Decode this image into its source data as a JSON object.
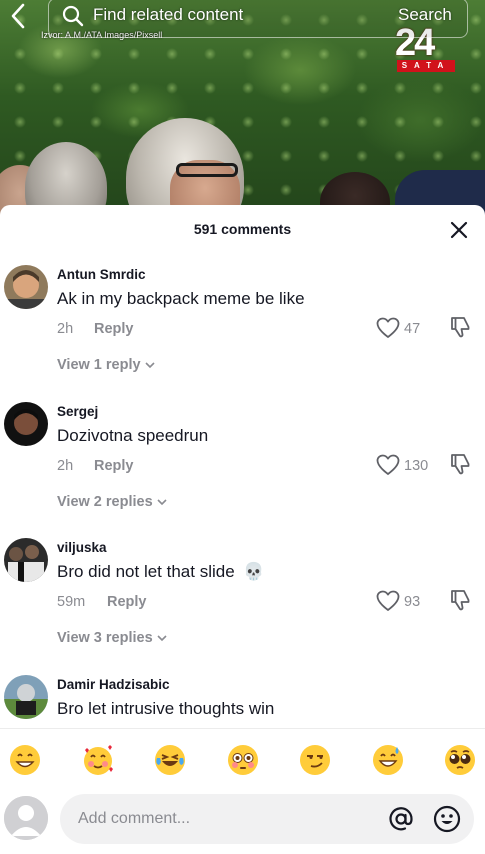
{
  "video": {
    "source_tag": "Izvor: A.M./ATA Images/Pixsell",
    "brand_number": "24",
    "brand_bar": "SATA"
  },
  "topbar": {
    "search_placeholder": "Find related content",
    "search_button": "Search"
  },
  "comments_panel": {
    "count_label": "591 comments",
    "comments": [
      {
        "username": "Antun Smrdic",
        "text": "Ak in my backpack meme be like",
        "time": "2h",
        "reply_label": "Reply",
        "likes": "47",
        "view_replies": "View 1 reply"
      },
      {
        "username": "Sergej",
        "text": "Dozivotna speedrun",
        "time": "2h",
        "reply_label": "Reply",
        "likes": "130",
        "view_replies": "View 2 replies"
      },
      {
        "username": "viljuska",
        "text": "Bro did not let that slide",
        "emoji": "💀",
        "time": "59m",
        "reply_label": "Reply",
        "likes": "93",
        "view_replies": "View 3 replies"
      },
      {
        "username": "Damir Hadzisabic",
        "text": "Bro let intrusive thoughts win"
      }
    ]
  },
  "emoji_bar": {
    "emojis": [
      "😁",
      "🥰",
      "😂",
      "😳",
      "😏",
      "😅",
      "🥺"
    ]
  },
  "input": {
    "placeholder": "Add comment..."
  },
  "colors": {
    "primary_text": "#161823",
    "secondary_text": "#8a8b91",
    "input_bg": "#f1f1f2"
  }
}
